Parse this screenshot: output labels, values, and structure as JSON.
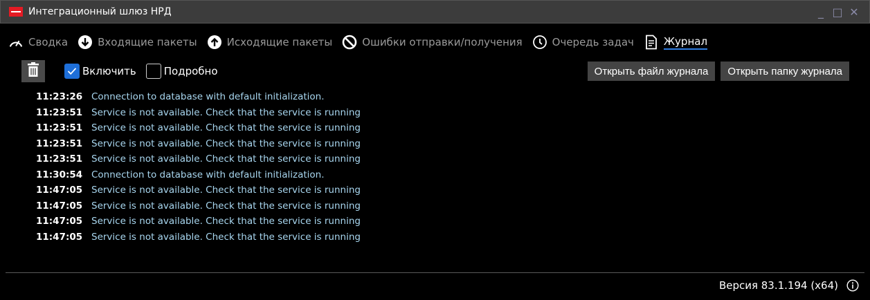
{
  "window": {
    "title": "Интеграционный шлюз НРД",
    "controls": {
      "minimize": "_",
      "maximize": "□",
      "close": "✕"
    }
  },
  "tabs": [
    {
      "label": "Сводка",
      "icon": "gauge-icon",
      "active": false
    },
    {
      "label": "Входящие пакеты",
      "icon": "arrow-down-circle-icon",
      "active": false
    },
    {
      "label": "Исходящие пакеты",
      "icon": "arrow-up-circle-icon",
      "active": false
    },
    {
      "label": "Ошибки отправки/получения",
      "icon": "prohibited-icon",
      "active": false
    },
    {
      "label": "Очередь задач",
      "icon": "clock-icon",
      "active": false
    },
    {
      "label": "Журнал",
      "icon": "document-icon",
      "active": true
    }
  ],
  "toolbar": {
    "enable_label": "Включить",
    "enable_checked": true,
    "verbose_label": "Подробно",
    "verbose_checked": false,
    "open_file_label": "Открыть файл журнала",
    "open_folder_label": "Открыть папку журнала"
  },
  "log": [
    {
      "time": "11:23:26",
      "message": "Connection to database with default initialization."
    },
    {
      "time": "11:23:51",
      "message": "Service is not available. Check that the service is running"
    },
    {
      "time": "11:23:51",
      "message": "Service is not available. Check that the service is running"
    },
    {
      "time": "11:23:51",
      "message": "Service is not available. Check that the service is running"
    },
    {
      "time": "11:23:51",
      "message": "Service is not available. Check that the service is running"
    },
    {
      "time": "11:30:54",
      "message": "Connection to database with default initialization."
    },
    {
      "time": "11:47:05",
      "message": "Service is not available. Check that the service is running"
    },
    {
      "time": "11:47:05",
      "message": "Service is not available. Check that the service is running"
    },
    {
      "time": "11:47:05",
      "message": "Service is not available. Check that the service is running"
    },
    {
      "time": "11:47:05",
      "message": "Service is not available. Check that the service is running"
    }
  ],
  "footer": {
    "version": "Версия 83.1.194 (x64)"
  },
  "colors": {
    "accent": "#1e6fd9",
    "log_message": "#a8d6ef",
    "brand_red": "#e51b24"
  }
}
